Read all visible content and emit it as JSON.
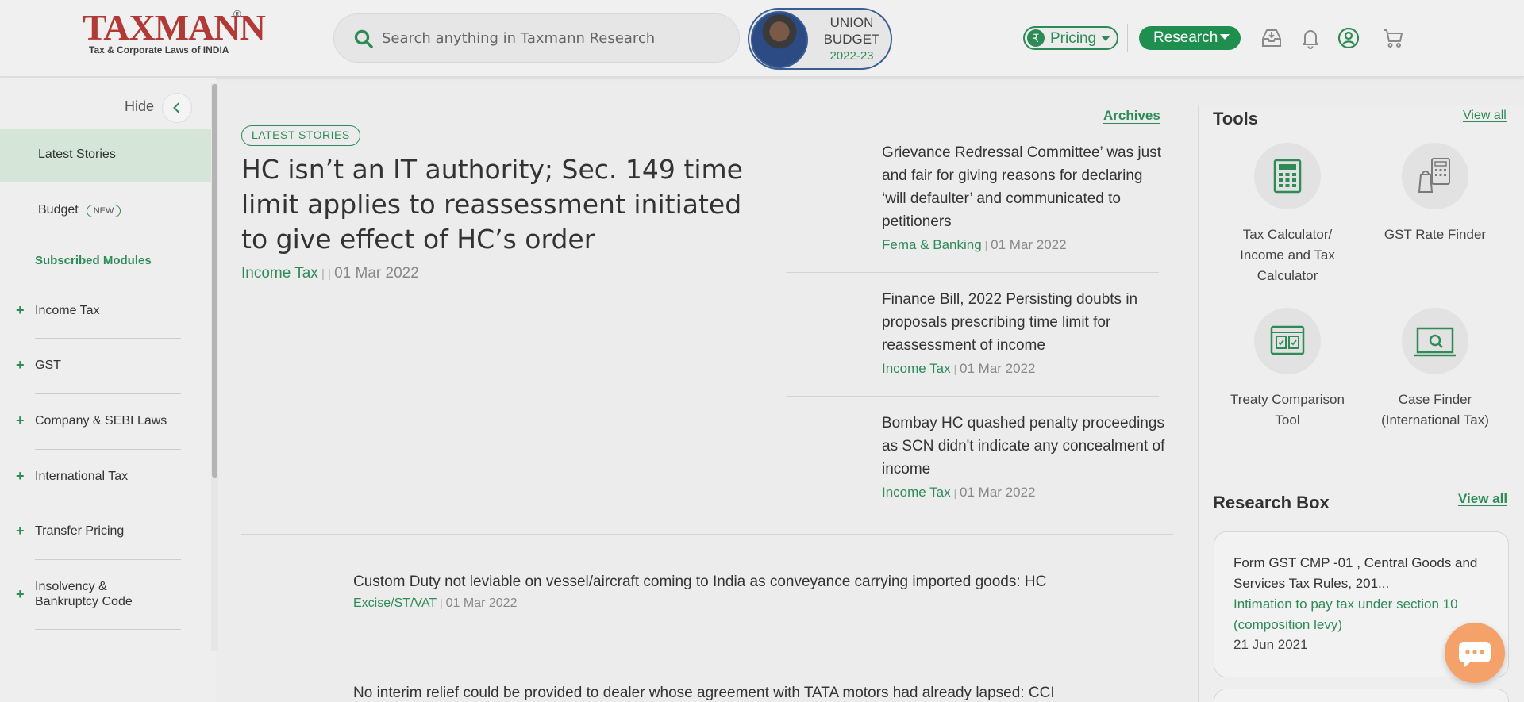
{
  "header": {
    "logo": {
      "brand": "TAXMANN",
      "reg": "®",
      "tagline": "Tax & Corporate Laws of INDIA"
    },
    "search": {
      "placeholder": "Search anything in Taxmann Research"
    },
    "budget": {
      "line1": "UNION",
      "line2": "BUDGET",
      "year": "2022-23"
    },
    "pricing": {
      "label": "Pricing",
      "currency": "₹"
    },
    "research": {
      "label": "Research"
    },
    "icons": [
      "inbox-download-icon",
      "bell-icon",
      "user-icon",
      "cart-icon"
    ]
  },
  "sidebar": {
    "hide_label": "Hide",
    "items": [
      {
        "label": "Latest Stories",
        "active": true
      },
      {
        "label": "Budget",
        "badge": "NEW"
      }
    ],
    "subscribed_label": "Subscribed Modules",
    "modules": [
      "Income Tax",
      "GST",
      "Company & SEBI Laws",
      "International Tax",
      "Transfer Pricing",
      "Insolvency & Bankruptcy Code"
    ]
  },
  "main": {
    "badge": "LATEST STORIES",
    "archives_label": "Archives",
    "featured": {
      "title": "HC isn’t an IT authority; Sec. 149 time limit applies to reassessment initiated to give effect of HC’s order",
      "category": "Income Tax",
      "sep": " | | ",
      "date": "01 Mar 2022"
    },
    "side_stories": [
      {
        "title": "Grievance Redressal Committee’ was just and fair for giving reasons for declaring ‘will defaulter’ and communicated to petitioners",
        "category": "Fema & Banking",
        "date": "01 Mar 2022"
      },
      {
        "title": "Finance Bill, 2022 Persisting doubts in proposals prescribing time limit for reassessment of income",
        "category": "Income Tax",
        "date": "01 Mar 2022"
      },
      {
        "title": "Bombay HC quashed penalty proceedings as SCN didn't indicate any concealment of income",
        "category": "Income Tax",
        "date": "01 Mar 2022"
      }
    ],
    "list_stories": [
      {
        "title": "Custom Duty not leviable on vessel/aircraft coming to India as conveyance carrying imported goods: HC",
        "category": "Excise/ST/VAT",
        "date": "01 Mar 2022"
      },
      {
        "title": "No interim relief could be provided to dealer whose agreement with TATA motors had already lapsed: CCI"
      }
    ],
    "meta_sep": " | "
  },
  "right": {
    "tools_title": "Tools",
    "tools_viewall": "View all",
    "tools": [
      {
        "icon": "calculator-icon",
        "label": "Tax Calculator/ Income and Tax Calculator"
      },
      {
        "icon": "gst-rate-finder-icon",
        "label": "GST Rate Finder"
      },
      {
        "icon": "treaty-comparison-icon",
        "label": "Treaty Comparison Tool"
      },
      {
        "icon": "case-finder-icon",
        "label": "Case Finder (International Tax)"
      }
    ],
    "research_title": "Research Box",
    "research_viewall": "View all",
    "research_card": {
      "title": "Form GST CMP -01 , Central Goods and Services Tax Rules, 201...",
      "subtitle": "Intimation to pay tax under section 10 (composition levy)",
      "date": "21 Jun 2021"
    }
  },
  "colors": {
    "accent": "#2e8b57",
    "brand": "#b23a36",
    "chat": "#f4a26a"
  }
}
